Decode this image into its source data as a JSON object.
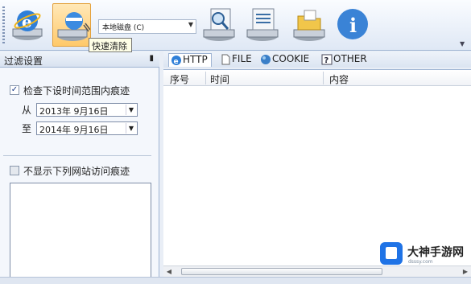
{
  "toolbar": {
    "drive_select_value": "本地磁盘 (C)",
    "tooltip": "快速清除",
    "buttons": [
      {
        "icon": "ie-cleanup-icon"
      },
      {
        "icon": "quick-clean-icon"
      },
      {
        "icon": "drive-scan-icon"
      },
      {
        "icon": "drive-report-icon"
      },
      {
        "icon": "folder-drive-icon"
      },
      {
        "icon": "info-icon"
      }
    ]
  },
  "left_panel": {
    "title": "过滤设置",
    "time_range_checkbox_label": "检查下设时间范围内痕迹",
    "time_range_checked": true,
    "from_label": "从",
    "from_date": "2013年  9月16日",
    "to_label": "至",
    "to_date": "2014年  9月16日",
    "exclude_sites_checkbox_label": "不显示下列网站访问痕迹",
    "exclude_sites_checked": false
  },
  "tabs": [
    {
      "label": "HTTP",
      "icon": "ie-icon",
      "active": true
    },
    {
      "label": "FILE",
      "icon": "file-icon",
      "active": false
    },
    {
      "label": "COOKIE",
      "icon": "cookie-icon",
      "active": false
    },
    {
      "label": "OTHER",
      "icon": "question-icon",
      "active": false
    }
  ],
  "table": {
    "columns": [
      "序号",
      "时间",
      "内容"
    ],
    "rows": []
  },
  "watermark": {
    "name": "大神手游网",
    "url": "dsssy.com"
  },
  "colors": {
    "toolbar_bg": "#dfe8f5",
    "panel_bg": "#f4f7fc",
    "active_button": "#ffc96a",
    "watermark_blue": "#1f73e6"
  }
}
